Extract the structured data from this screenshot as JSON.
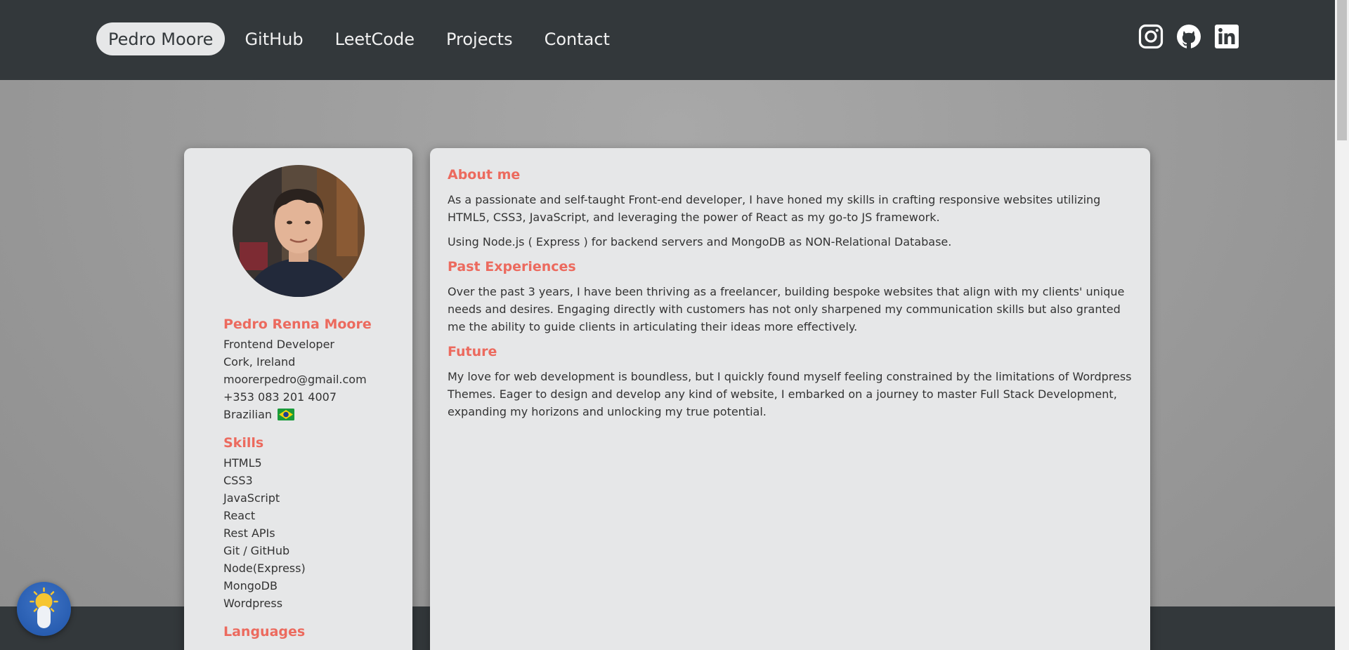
{
  "nav": {
    "items": [
      {
        "label": "Pedro Moore",
        "active": true
      },
      {
        "label": "GitHub",
        "active": false
      },
      {
        "label": "LeetCode",
        "active": false
      },
      {
        "label": "Projects",
        "active": false
      },
      {
        "label": "Contact",
        "active": false
      }
    ],
    "socials": [
      "instagram-icon",
      "github-icon",
      "linkedin-icon"
    ]
  },
  "profile": {
    "name": "Pedro Renna Moore",
    "title": "Frontend Developer",
    "location": "Cork, Ireland",
    "email": "moorerpedro@gmail.com",
    "phone": "+353 083 201 4007",
    "nationality": "Brazilian",
    "flag_icon": "brazil-flag-icon"
  },
  "skills": {
    "heading": "Skills",
    "items": [
      "HTML5",
      "CSS3",
      "JavaScript",
      "React",
      "Rest APIs",
      "Git / GitHub",
      "Node(Express)",
      "MongoDB",
      "Wordpress"
    ]
  },
  "languages": {
    "heading": "Languages"
  },
  "about": {
    "heading": "About me",
    "paragraphs": [
      "As a passionate and self-taught Front-end developer, I have honed my skills in crafting responsive websites utilizing HTML5, CSS3, JavaScript, and leveraging the power of React as my go-to JS framework.",
      "Using Node.js ( Express ) for backend servers and MongoDB as NON-Relational Database."
    ]
  },
  "experience": {
    "heading": "Past Experiences",
    "paragraphs": [
      "Over the past 3 years, I have been thriving as a freelancer, building bespoke websites that align with my clients' unique needs and desires. Engaging directly with customers has not only sharpened my communication skills but also granted me the ability to guide clients in articulating their ideas more effectively."
    ]
  },
  "future": {
    "heading": "Future",
    "paragraphs": [
      "My love for web development is boundless, but I quickly found myself feeling constrained by the limitations of Wordpress Themes. Eager to design and develop any kind of website, I embarked on a journey to master Full Stack Development, expanding my horizons and unlocking my true potential."
    ]
  },
  "colors": {
    "accent": "#ec6a5e",
    "topbar": "#33383b",
    "card": "#e6e7e8",
    "text": "#333333"
  },
  "theme_toggle": {
    "icon": "sun-toggle-icon"
  }
}
